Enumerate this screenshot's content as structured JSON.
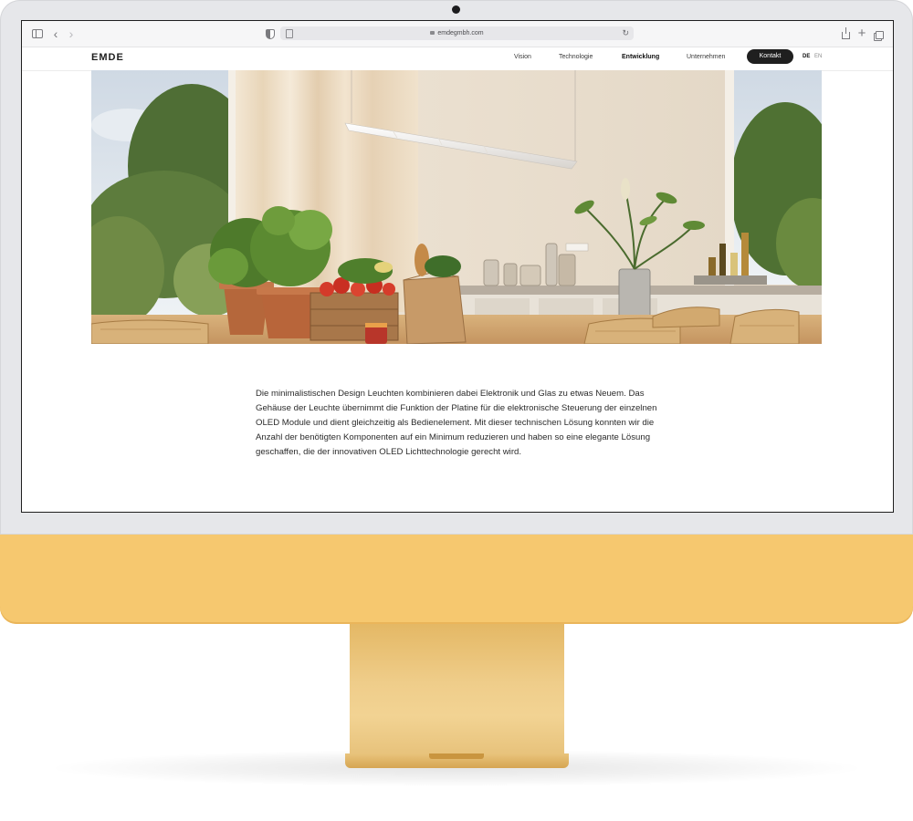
{
  "browser": {
    "url": "emdegmbh.com"
  },
  "site": {
    "logo": "EMDE",
    "nav": {
      "vision": "Vision",
      "technologie": "Technologie",
      "entwicklung": "Entwicklung",
      "unternehmen": "Unternehmen"
    },
    "contact_button": "Kontakt",
    "lang_de": "DE",
    "lang_en": "EN"
  },
  "hero": {
    "alt": "Kitchen interior with OLED pendant light above a table with plants and vegetables"
  },
  "content": {
    "paragraph": "Die minimalistischen Design Leuchten kombinieren dabei Elektronik und Glas zu etwas Neuem. Das Gehäuse der Leuchte übernimmt die Funktion der Platine für die elektronische Steuerung  der einzelnen OLED Module und dient gleichzeitig als Bedienelement. Mit dieser technischen Lösung konnten wir die Anzahl der benötigten Komponenten auf ein Minimum reduzieren und haben so eine elegante Lösung geschaffen, die der innovativen OLED Lichttechnologie gerecht wird."
  },
  "device": {
    "accent_color": "#f6c86f",
    "bezel_color": "#e6e7ea"
  }
}
